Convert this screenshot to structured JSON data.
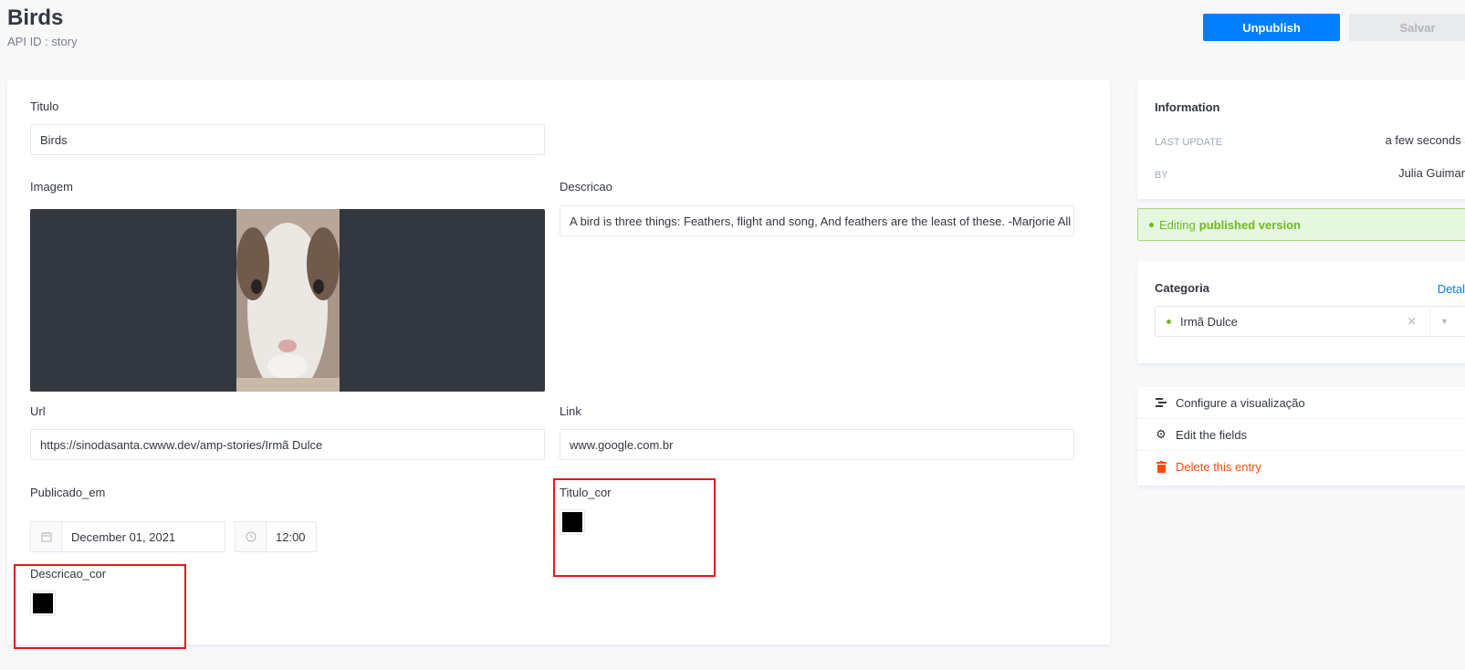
{
  "header": {
    "title": "Birds",
    "api_id": "API ID : story",
    "unpublish_label": "Unpublish",
    "save_label": "Salvar"
  },
  "form": {
    "titulo_label": "Titulo",
    "titulo_value": "Birds",
    "imagem_label": "Imagem",
    "descricao_label": "Descricao",
    "descricao_value": "A bird is three things: Feathers, flight and song, And feathers are the least of these. -Marjorie All",
    "url_label": "Url",
    "url_value": "https://sinodasanta.cwww.dev/amp-stories/Irmã Dulce",
    "link_label": "Link",
    "link_value": "www.google.com.br",
    "publicado_label": "Publicado_em",
    "publicado_date": "December 01, 2021",
    "publicado_time": "12:00",
    "titulo_cor_label": "Titulo_cor",
    "titulo_cor_value": "#000000",
    "descricao_cor_label": "Descricao_cor",
    "descricao_cor_value": "#000000"
  },
  "info": {
    "title": "Information",
    "last_update_label": "LAST UPDATE",
    "last_update_value": "a few seconds ago",
    "by_label": "BY",
    "by_value": "Julia Guimarães"
  },
  "banner": {
    "prefix": "Editing",
    "emphasis": "published version"
  },
  "categoria": {
    "title": "Categoria",
    "details_link": "Detalhes",
    "selected": "Irmã Dulce"
  },
  "actions": {
    "configure": "Configure a visualização",
    "edit_fields": "Edit the fields",
    "delete": "Delete this entry"
  }
}
